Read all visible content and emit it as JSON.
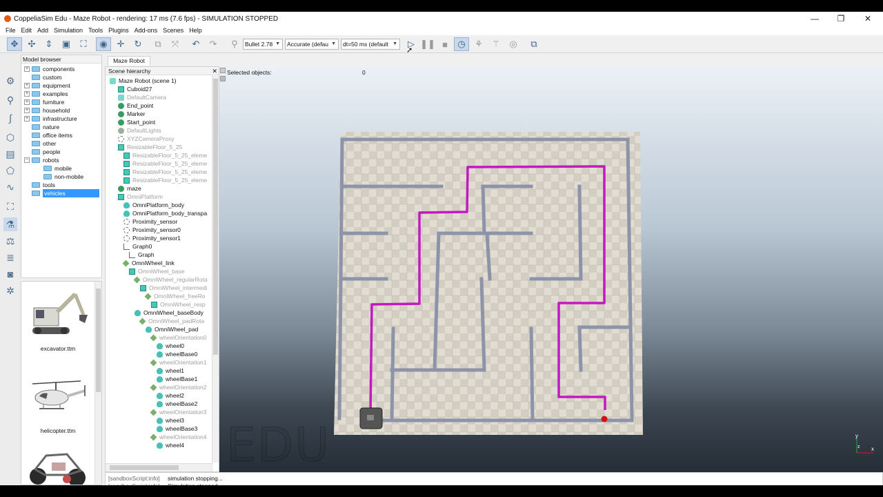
{
  "window": {
    "title": "CoppeliaSim Edu - Maze Robot - rendering: 17 ms (7.6 fps) - SIMULATION STOPPED",
    "min_glyph": "—",
    "max_glyph": "❐",
    "close_glyph": "✕"
  },
  "menu": [
    "File",
    "Edit",
    "Add",
    "Simulation",
    "Tools",
    "Plugins",
    "Add-ons",
    "Scenes",
    "Help"
  ],
  "toolbar": {
    "physics_engine": "Bullet 2.78",
    "accuracy": "Accurate (defau",
    "timestep": "dt=50 ms (default"
  },
  "model_browser": {
    "title": "Model browser",
    "items": [
      "components",
      "custom",
      "equipment",
      "examples",
      "furniture",
      "household",
      "infrastructure",
      "nature",
      "office items",
      "other",
      "people",
      "robots",
      "mobile",
      "non-mobile",
      "tools",
      "vehicles"
    ],
    "selected": "vehicles",
    "thumbnails": [
      "excavator.ttm",
      "helicopter.ttm"
    ]
  },
  "tab": "Maze Robot",
  "scene_hierarchy": {
    "title": "Scene hierarchy",
    "items": [
      "Maze Robot (scene 1)",
      "Cuboid27",
      "DefaultCamera",
      "End_point",
      "Marker",
      "Start_point",
      "DefaultLights",
      "XYZCameraProxy",
      "ResizableFloor_5_25",
      "ResizableFloor_5_25_eleme",
      "ResizableFloor_5_25_eleme",
      "ResizableFloor_5_25_eleme",
      "ResizableFloor_5_25_eleme",
      "maze",
      "OmniPlatform",
      "OmniPlatform_body",
      "OmniPlatform_body_transpa",
      "Proximity_sensor",
      "Proximity_sensor0",
      "Proximity_sensor1",
      "Graph0",
      "Graph",
      "OmniWheel_link",
      "OmniWheel_base",
      "OmniWheel_regularRota",
      "OmniWheel_intermedi",
      "OmniWheel_freeRo",
      "OmniWheel_resp",
      "OmniWheel_baseBody",
      "OmniWheel_padRota",
      "OmniWheel_pad",
      "wheelOrientation0",
      "wheel0",
      "wheelBase0",
      "wheelOrientation1",
      "wheel1",
      "wheelBase1",
      "wheelOrientation2",
      "wheel2",
      "wheelBase2",
      "wheelOrientation3",
      "wheel3",
      "wheelBase3",
      "wheelOrientation4",
      "wheel4"
    ]
  },
  "viewport": {
    "selected_label": "Selected objects:",
    "selected_count": "0",
    "watermark": "EDU",
    "axis_y": "y",
    "axis_z": "z",
    "axis_x": "x"
  },
  "console": [
    {
      "src": "[sandboxScript:info]",
      "msg": "simulation stopping..."
    },
    {
      "src": "[sandboxScript:info]",
      "msg": "Simulation stopped."
    }
  ],
  "colors": {
    "path": "#c21ac0",
    "selection": "#3399ff",
    "end_marker": "#d21313"
  }
}
